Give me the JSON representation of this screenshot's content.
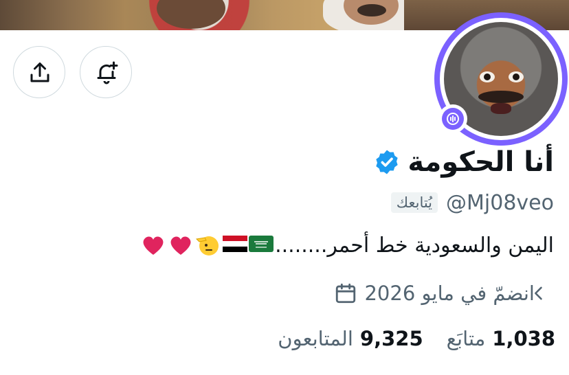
{
  "profile": {
    "name": "أنا الحكومة",
    "handle": "@Mj08veo",
    "follows_you": "يُتابعك",
    "bio": "اليمن والسعودية خط أحمر........",
    "joined": "انضمّ في مايو 2026",
    "following_count": "1,038",
    "following_label": "متابَع",
    "followers_count": "9,325",
    "followers_label": "المتابعون"
  },
  "colors": {
    "accent": "#7b61ff",
    "verified": "#1d9bf0",
    "secondary_text": "#536471",
    "heart": "#e0245e"
  },
  "icons": {
    "share": "share-icon",
    "notify": "bell-plus-icon",
    "verified": "verified-badge-icon",
    "calendar": "calendar-icon",
    "chevron": "chevron-left-icon",
    "spaces": "spaces-icon"
  }
}
